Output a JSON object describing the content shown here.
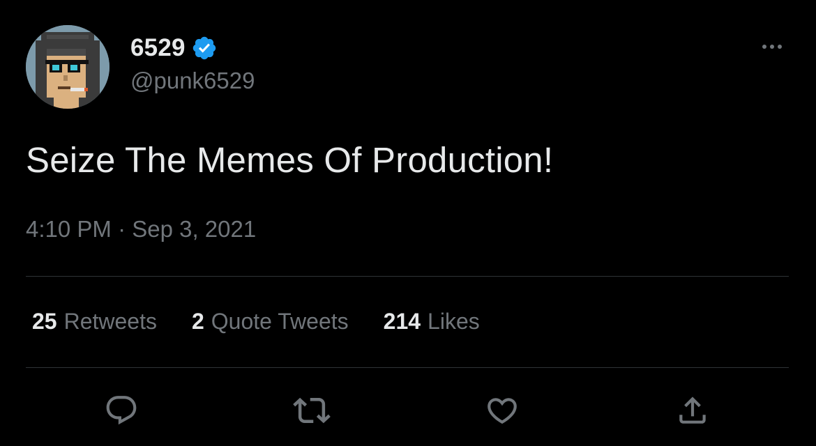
{
  "author": {
    "display_name": "6529",
    "handle": "@punk6529",
    "verified": true,
    "avatar_icon": "pixel-punk-avatar"
  },
  "tweet": {
    "text": "Seize The Memes Of Production!",
    "timestamp": "4:10 PM · Sep 3, 2021"
  },
  "stats": {
    "retweets": {
      "count": "25",
      "label": "Retweets"
    },
    "quotes": {
      "count": "2",
      "label": "Quote Tweets"
    },
    "likes": {
      "count": "214",
      "label": "Likes"
    }
  },
  "actions": [
    "reply-icon",
    "retweet-icon",
    "like-icon",
    "share-icon"
  ],
  "colors": {
    "background": "#000000",
    "text_primary": "#e7e9ea",
    "text_secondary": "#71767b",
    "divider": "#2f3336",
    "verified_badge": "#1d9bf0"
  }
}
